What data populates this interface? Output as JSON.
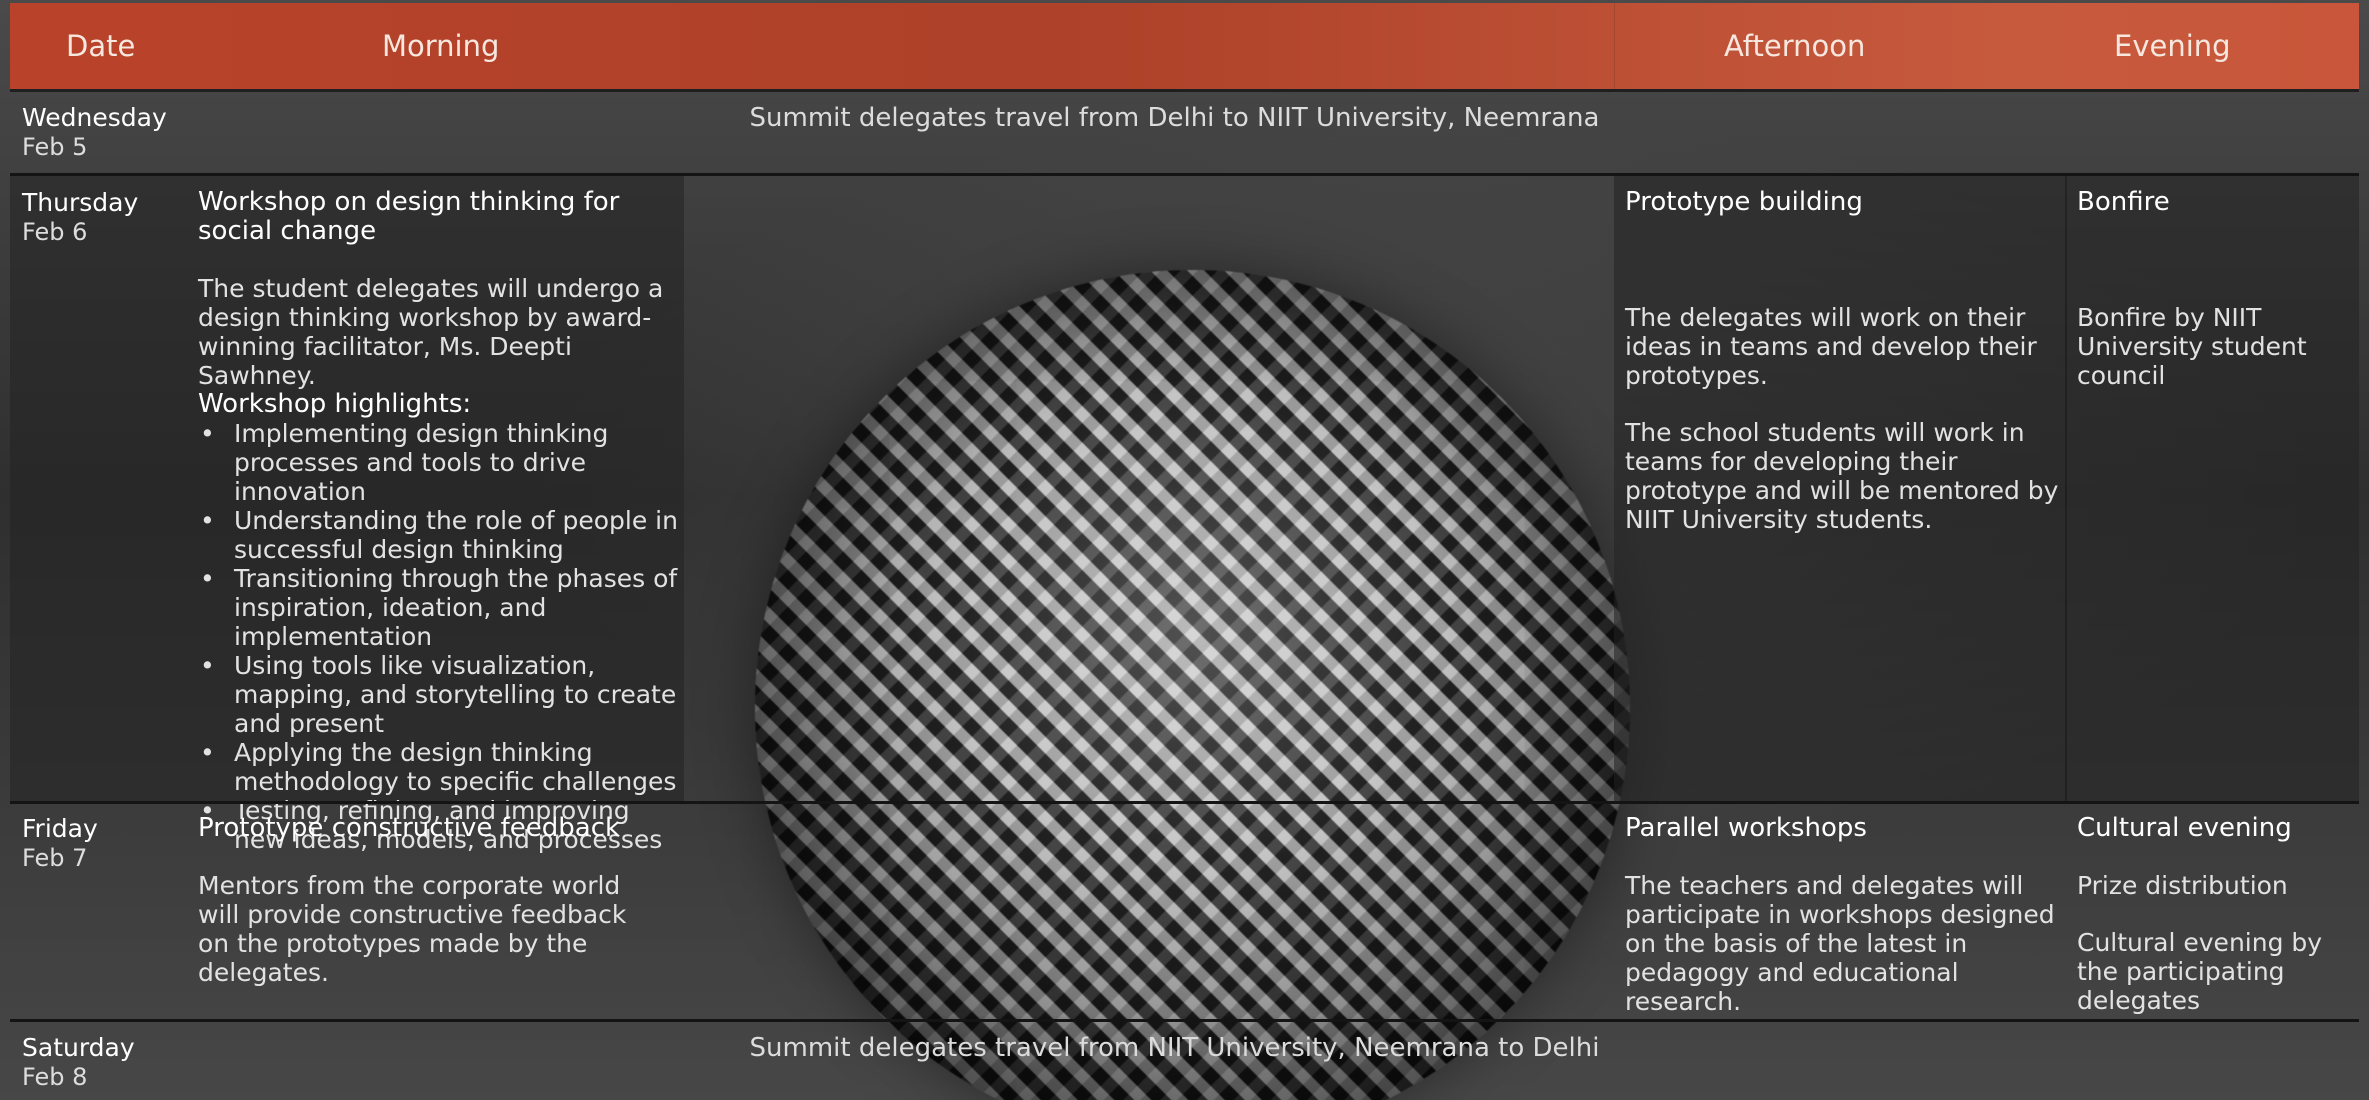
{
  "header": {
    "date": "Date",
    "morning": "Morning",
    "afternoon": "Afternoon",
    "evening": "Evening"
  },
  "days": [
    {
      "day": "Wednesday",
      "date": "Feb 5",
      "span": "Summit delegates travel from Delhi to NIIT University, Neemrana"
    },
    {
      "day": "Thursday",
      "date": "Feb 6",
      "morning": {
        "title": "Workshop on design thinking for social change",
        "text": "The student delegates will undergo a design thinking workshop by award-winning facilitator, Ms. Deepti Sawhney.",
        "highlights_label": "Workshop highlights:",
        "highlights": [
          "Implementing design thinking processes and tools to drive innovation",
          "Understanding the role of people in successful design thinking",
          "Transitioning through the phases of inspiration, ideation, and implementation",
          "Using tools like visualization, mapping, and storytelling to create and present",
          "Applying the design thinking methodology to specific challenges",
          "Testing, refining, and improving new ideas, models, and processes"
        ]
      },
      "afternoon": {
        "title": "Prototype building",
        "p1": "The delegates will work on their ideas in teams and develop their prototypes.",
        "p2": "The school students will work in teams for developing their prototype and will be mentored by NIIT University students."
      },
      "evening": {
        "title": "Bonfire",
        "p1": "Bonfire by NIIT University student council"
      }
    },
    {
      "day": "Friday",
      "date": "Feb 7",
      "morning": {
        "title": "Prototype constructive feedback",
        "text": "Mentors from the corporate world will provide constructive feedback on the prototypes made by the delegates."
      },
      "afternoon": {
        "title": "Parallel workshops",
        "p1": "The teachers and delegates will participate in workshops designed on the basis of the latest in pedagogy and educational research."
      },
      "evening": {
        "title": "Cultural evening",
        "p1": "Prize distribution",
        "p2": "Cultural evening by the participating delegates"
      }
    },
    {
      "day": "Saturday",
      "date": "Feb 8",
      "span": "Summit delegates travel from NIIT University, Neemrana to Delhi"
    }
  ]
}
